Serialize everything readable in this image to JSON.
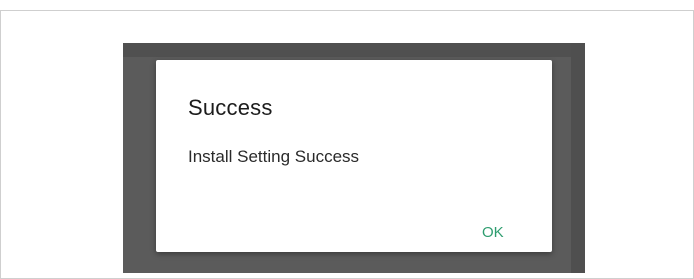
{
  "dialog": {
    "title": "Success",
    "message": "Install Setting Success",
    "ok_label": "OK"
  },
  "colors": {
    "accent": "#2e9d6f",
    "scrim": "#5b5b5b",
    "dialog_background": "#ffffff"
  }
}
